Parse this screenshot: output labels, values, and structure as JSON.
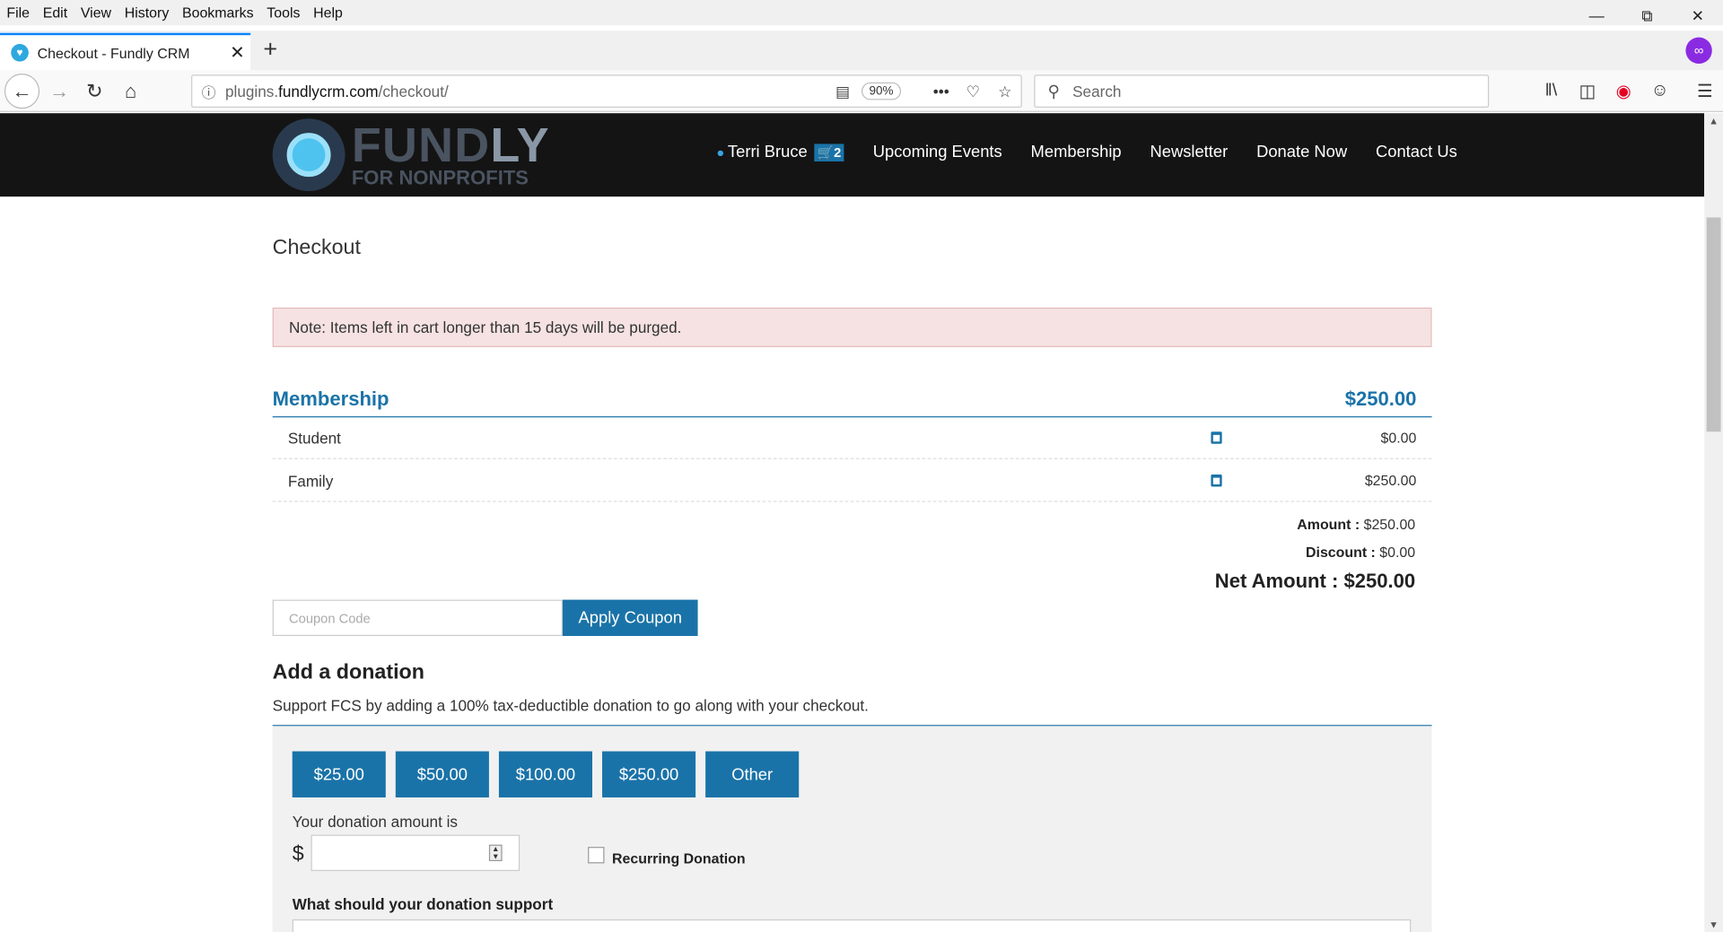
{
  "browser": {
    "menu": [
      "File",
      "Edit",
      "View",
      "History",
      "Bookmarks",
      "Tools",
      "Help"
    ],
    "tab_title": "Checkout - Fundly CRM",
    "url_host_prefix": "plugins.",
    "url_host": "fundlycrm.com",
    "url_path": "/checkout/",
    "zoom": "90%",
    "search_placeholder": "Search"
  },
  "site": {
    "logo_word1": "FUND",
    "logo_word2": "LY",
    "logo_sub": "FOR NONPROFITS",
    "user_name": "Terri Bruce",
    "cart_count": "2",
    "nav": [
      "Upcoming Events",
      "Membership",
      "Newsletter",
      "Donate Now",
      "Contact Us"
    ]
  },
  "checkout": {
    "title": "Checkout",
    "note": "Note: Items left in cart longer than 15 days will be purged.",
    "section_title": "Membership",
    "section_total": "$250.00",
    "items": [
      {
        "name": "Student",
        "amount": "$0.00"
      },
      {
        "name": "Family",
        "amount": "$250.00"
      }
    ],
    "amount_label": "Amount :",
    "amount_value": "$250.00",
    "discount_label": "Discount :",
    "discount_value": "$0.00",
    "net_label": "Net Amount :",
    "net_value": "$250.00",
    "coupon_placeholder": "Coupon Code",
    "apply_label": "Apply Coupon"
  },
  "donation": {
    "title": "Add a donation",
    "subtitle": "Support FCS by adding a 100% tax-deductible donation to go along with your checkout.",
    "options": [
      "$25.00",
      "$50.00",
      "$100.00",
      "$250.00",
      "Other"
    ],
    "amount_label": "Your donation amount is",
    "currency": "$",
    "recurring_label": "Recurring Donation",
    "support_label": "What should your donation support"
  },
  "colors": {
    "accent": "#1a73a8",
    "header_bg": "#141414",
    "note_bg": "#f6e2e2"
  }
}
